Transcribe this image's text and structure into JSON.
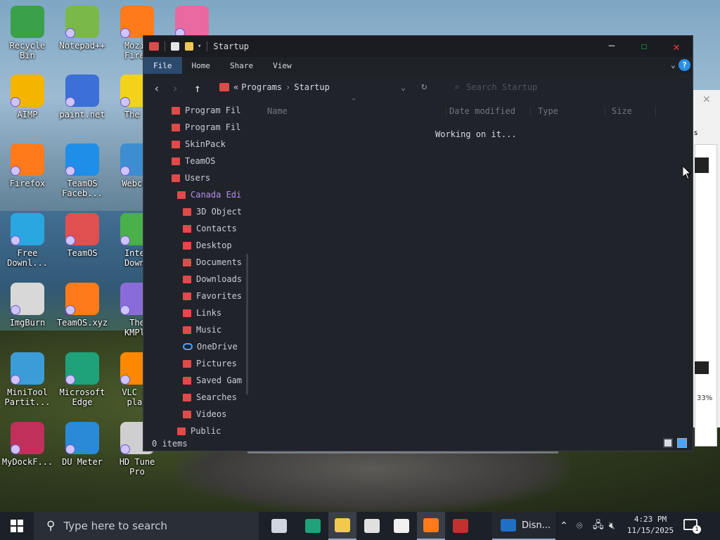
{
  "desktop": {
    "icons": [
      {
        "label": "Recycle\nBin",
        "icon": "recycle-bin-icon",
        "color": "#3aa04a"
      },
      {
        "label": "Notepad++",
        "icon": "notepad-plus-plus-icon",
        "color": "#7ab84a"
      },
      {
        "label": "Mozil\nFiref",
        "icon": "firefox-icon",
        "color": "#ff7a1a"
      },
      {
        "label": "",
        "icon": "heart-monitor-icon",
        "color": "#e86aa0"
      },
      {
        "label": "AIMP",
        "icon": "aimp-icon",
        "color": "#f4b400"
      },
      {
        "label": "paint.net",
        "icon": "paint-net-icon",
        "color": "#3c6fd8"
      },
      {
        "label": "The B",
        "icon": "batman-icon",
        "color": "#f2d21b"
      },
      {
        "label": "Firefox",
        "icon": "firefox-icon",
        "color": "#ff7a1a"
      },
      {
        "label": "TeamOS\nFaceb...",
        "icon": "gear-icon",
        "color": "#1f8ee8"
      },
      {
        "label": "Webcam",
        "icon": "webcam-icon",
        "color": "#3c8ed0"
      },
      {
        "label": "Free\nDownl...",
        "icon": "download-arrow-icon",
        "color": "#2aa7e0"
      },
      {
        "label": "TeamOS",
        "icon": "teamos-icon",
        "color": "#e05050"
      },
      {
        "label": "Inter\nDownl",
        "icon": "globe-icon",
        "color": "#4ab04a"
      },
      {
        "label": "ImgBurn",
        "icon": "disc-fire-icon",
        "color": "#d8d8d8"
      },
      {
        "label": "TeamOS.xyz",
        "icon": "firefox-file-icon",
        "color": "#ff7a1a"
      },
      {
        "label": "The\nKMPla",
        "icon": "play-icon",
        "color": "#8a6cd8"
      },
      {
        "label": "MiniTool\nPartit...",
        "icon": "minitool-icon",
        "color": "#3c9cd8"
      },
      {
        "label": "Microsoft\nEdge",
        "icon": "edge-icon",
        "color": "#1fa27a"
      },
      {
        "label": "VLC me\nplay",
        "icon": "vlc-cone-icon",
        "color": "#ff8800"
      },
      {
        "label": "MyDockF...",
        "icon": "dock-icon",
        "color": "#c0305a"
      },
      {
        "label": "DU Meter",
        "icon": "du-meter-icon",
        "color": "#2a8ad8"
      },
      {
        "label": "HD Tune\nPro",
        "icon": "hd-tune-icon",
        "color": "#cfcfcf"
      }
    ]
  },
  "background_window": {
    "tab_fragment": "s",
    "percent": "33%"
  },
  "explorer": {
    "title": "Startup",
    "window_controls": {
      "minimize": "─",
      "maximize": "☐",
      "close": "✕"
    },
    "ribbon_tabs": [
      {
        "label": "File",
        "active": true
      },
      {
        "label": "Home",
        "active": false
      },
      {
        "label": "Share",
        "active": false
      },
      {
        "label": "View",
        "active": false
      }
    ],
    "help": "?",
    "breadcrumb": {
      "prefix": "«",
      "parts": [
        "Programs",
        "Startup"
      ],
      "separator": "›"
    },
    "search_placeholder": "Search Startup",
    "nav_tree": [
      {
        "label": "Program Fil",
        "indent": 0
      },
      {
        "label": "Program Fil",
        "indent": 0
      },
      {
        "label": "SkinPack",
        "indent": 0
      },
      {
        "label": "TeamOS",
        "indent": 0
      },
      {
        "label": "Users",
        "indent": 0
      },
      {
        "label": "Canada Edi",
        "indent": 1,
        "selected": true
      },
      {
        "label": "3D Object",
        "indent": 2
      },
      {
        "label": "Contacts",
        "indent": 2
      },
      {
        "label": "Desktop",
        "indent": 2
      },
      {
        "label": "Documents",
        "indent": 2
      },
      {
        "label": "Downloads",
        "indent": 2
      },
      {
        "label": "Favorites",
        "indent": 2
      },
      {
        "label": "Links",
        "indent": 2
      },
      {
        "label": "Music",
        "indent": 2
      },
      {
        "label": "OneDrive",
        "indent": 2,
        "cloud": true
      },
      {
        "label": "Pictures",
        "indent": 2
      },
      {
        "label": "Saved Gam",
        "indent": 2
      },
      {
        "label": "Searches",
        "indent": 2
      },
      {
        "label": "Videos",
        "indent": 2
      },
      {
        "label": "Public",
        "indent": 1
      }
    ],
    "columns": {
      "name": "Name",
      "date": "Date modified",
      "type": "Type",
      "size": "Size"
    },
    "working_text": "Working on it...",
    "status_count": "0 items"
  },
  "taskbar": {
    "search_placeholder": "Type here to search",
    "pinned": [
      {
        "icon": "task-view-icon",
        "color": "#cfd6df"
      },
      {
        "icon": "edge-icon",
        "color": "#1fa27a"
      },
      {
        "icon": "file-explorer-icon",
        "color": "#f2c94c",
        "active": true
      },
      {
        "icon": "store-icon",
        "color": "#e0e0e0"
      },
      {
        "icon": "mail-icon",
        "color": "#f0f0f0"
      },
      {
        "icon": "firefox-icon",
        "color": "#ff7a1a",
        "active": true
      },
      {
        "icon": "app-red-icon",
        "color": "#c23030"
      }
    ],
    "running_app": "Disn...",
    "time": "4:23 PM",
    "date": "11/15/2025",
    "notifications": "1"
  },
  "colors": {
    "accent": "#2c4a6e",
    "folder": "#e04a4a",
    "selected_text": "#b98cf0"
  }
}
